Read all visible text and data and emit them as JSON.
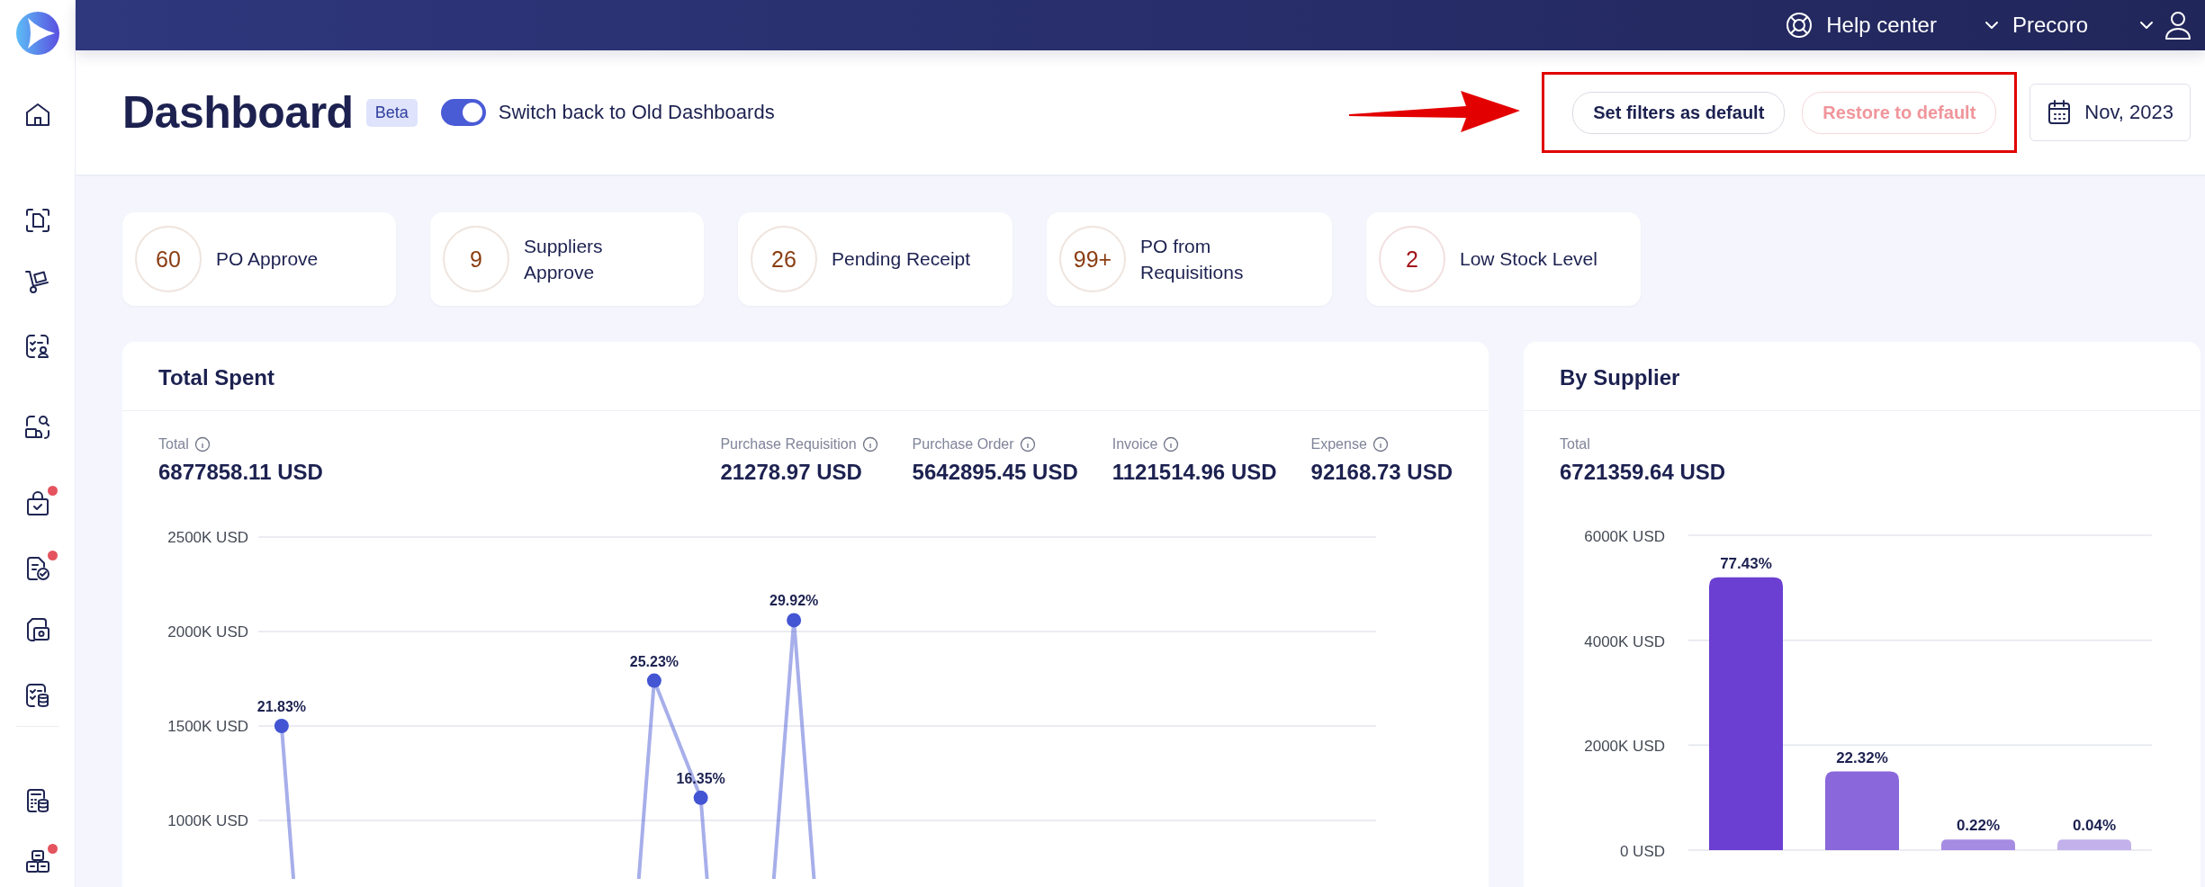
{
  "sidebar": {
    "items": [
      {
        "badge": false
      },
      {
        "badge": false
      },
      {
        "badge": false
      },
      {
        "badge": false
      },
      {
        "badge": false
      },
      {
        "badge": true
      },
      {
        "badge": true
      },
      {
        "badge": false
      },
      {
        "badge": false
      },
      {
        "badge": false
      },
      {
        "badge": true
      }
    ]
  },
  "top_bar": {
    "help": "Help center",
    "company": "Precoro"
  },
  "header": {
    "title": "Dashboard",
    "badge": "Beta",
    "toggle": {
      "label": "Switch back to Old Dashboards",
      "on": true
    },
    "buttons": [
      {
        "label": "Set filters as default",
        "disabled": false
      },
      {
        "label": "Restore to default",
        "disabled": true
      }
    ],
    "date": "Nov, 2023"
  },
  "tasks": [
    {
      "count": "60",
      "label": "PO Approve",
      "color": "#8a3d12"
    },
    {
      "count": "9",
      "label": "Suppliers Approve",
      "color": "#8a3d12"
    },
    {
      "count": "26",
      "label": "Pending Receipt",
      "color": "#8a3d12"
    },
    {
      "count": "99+",
      "label": "PO from Requisitions",
      "color": "#8a3d12"
    },
    {
      "count": "2",
      "label": "Low Stock Level",
      "color": "#a3161c"
    }
  ],
  "total_spent": {
    "title": "Total Spent",
    "stats": [
      {
        "label": "Total",
        "value": "6877858.11 USD"
      },
      {
        "label": "Purchase Requisition",
        "value": "21278.97 USD"
      },
      {
        "label": "Purchase Order",
        "value": "5642895.45 USD"
      },
      {
        "label": "Invoice",
        "value": "1121514.96 USD"
      },
      {
        "label": "Expense",
        "value": "92168.73 USD"
      }
    ],
    "chart_data": {
      "type": "line",
      "grid": true,
      "ylim": [
        1000,
        2500
      ],
      "categories": [
        null,
        null,
        null,
        null,
        null,
        null,
        null,
        null,
        null,
        null,
        null,
        null,
        null,
        null,
        null,
        null,
        null,
        null,
        null,
        null,
        null,
        null,
        null,
        null
      ],
      "yticks": [
        {
          "value": 2500,
          "label": "2500K USD"
        },
        {
          "value": 2000,
          "label": "2000K USD"
        },
        {
          "value": 1500,
          "label": "1500K USD"
        },
        {
          "value": 1000,
          "label": "1000K USD"
        }
      ],
      "series": [
        {
          "color": "#4355d3",
          "marker": true,
          "values": [
            1500,
            null,
            null,
            null,
            null,
            null,
            null,
            null,
            1740,
            1120,
            null,
            2060,
            null,
            null,
            null,
            null,
            null,
            null,
            null,
            null,
            null,
            null,
            null,
            null
          ]
        }
      ],
      "value_labels": [
        "21.83%",
        null,
        null,
        null,
        null,
        null,
        null,
        null,
        "25.23%",
        "16.35%",
        null,
        "29.92%",
        null,
        null,
        null,
        null,
        null,
        null,
        null,
        null,
        null,
        null,
        null,
        null
      ]
    }
  },
  "by_supplier": {
    "title": "By Supplier",
    "stat": {
      "label": "Total",
      "value": "6721359.64 USD"
    },
    "chart_data": {
      "type": "bar",
      "grid": true,
      "ylim": [
        0,
        6000
      ],
      "yticks": [
        {
          "value": 6000,
          "label": "6000K USD"
        },
        {
          "value": 4000,
          "label": "4000K USD"
        },
        {
          "value": 2000,
          "label": "2000K USD"
        },
        {
          "value": 0,
          "label": "0 USD"
        }
      ],
      "series": [
        {
          "colors": [
            "#6b3fd1",
            "#8a67da",
            "#a68be3",
            "#c3b1ec"
          ],
          "values": [
            5200,
            1500,
            200,
            200
          ]
        }
      ],
      "value_labels": [
        "77.43%",
        "22.32%",
        "0.22%",
        "0.04%"
      ]
    }
  }
}
